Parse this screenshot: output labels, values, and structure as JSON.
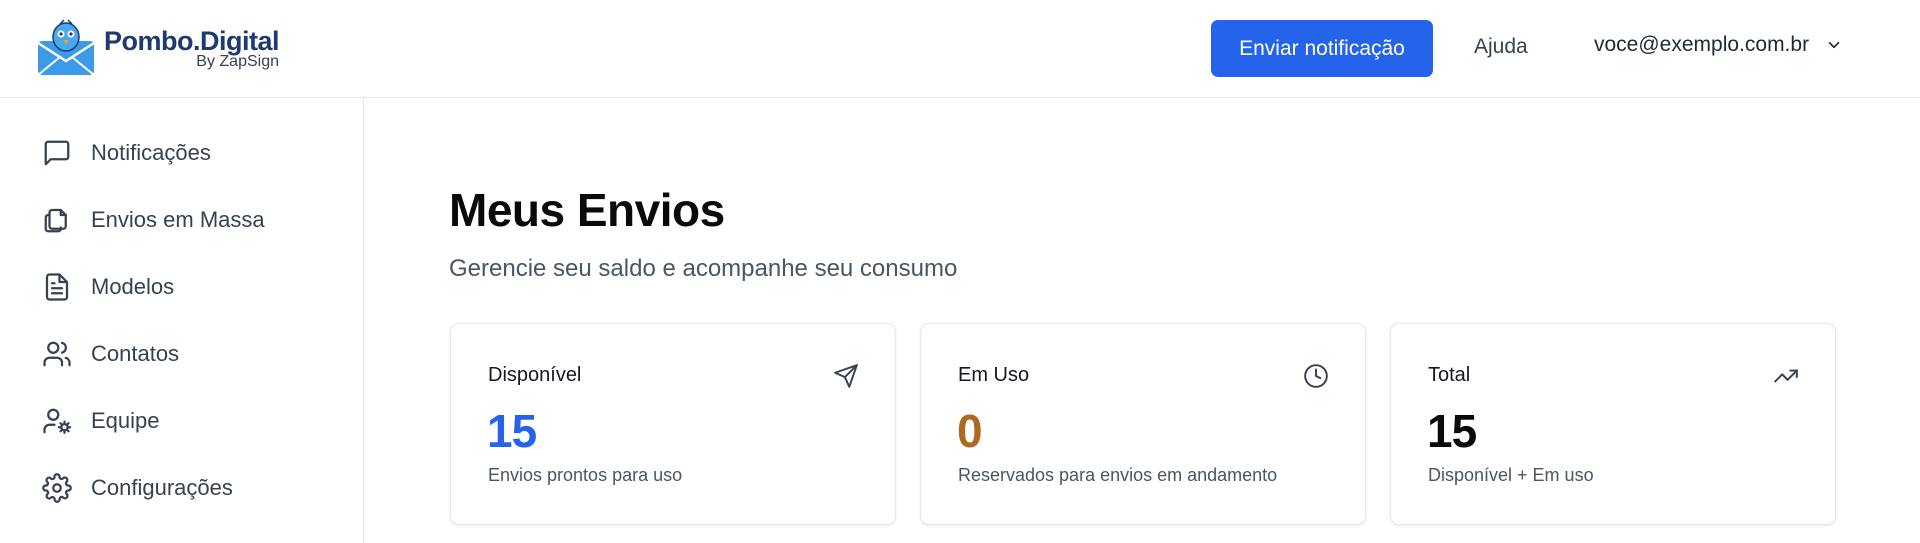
{
  "brand": {
    "name": "Pombo.Digital",
    "subtitle": "By ZapSign",
    "logo_icon": "envelope-bird-logo"
  },
  "header": {
    "primary_button": "Enviar notificação",
    "help_link": "Ajuda",
    "user_email": "voce@exemplo.com.br"
  },
  "sidebar": {
    "items": [
      {
        "label": "Notificações",
        "icon": "message-square-icon"
      },
      {
        "label": "Envios em Massa",
        "icon": "copy-files-icon"
      },
      {
        "label": "Modelos",
        "icon": "file-text-icon"
      },
      {
        "label": "Contatos",
        "icon": "users-icon"
      },
      {
        "label": "Equipe",
        "icon": "user-cog-icon"
      },
      {
        "label": "Configurações",
        "icon": "gear-icon"
      }
    ]
  },
  "main": {
    "title": "Meus Envios",
    "subtitle": "Gerencie seu saldo e acompanhe seu consumo",
    "cards": [
      {
        "label": "Disponível",
        "value": "15",
        "desc": "Envios prontos para uso",
        "icon": "send-icon",
        "color": "#2563eb"
      },
      {
        "label": "Em Uso",
        "value": "0",
        "desc": "Reservados para envios em andamento",
        "icon": "clock-icon",
        "color": "#b0671f"
      },
      {
        "label": "Total",
        "value": "15",
        "desc": "Disponível + Em uso",
        "icon": "trending-up-icon",
        "color": "#0a0a0a"
      }
    ]
  }
}
